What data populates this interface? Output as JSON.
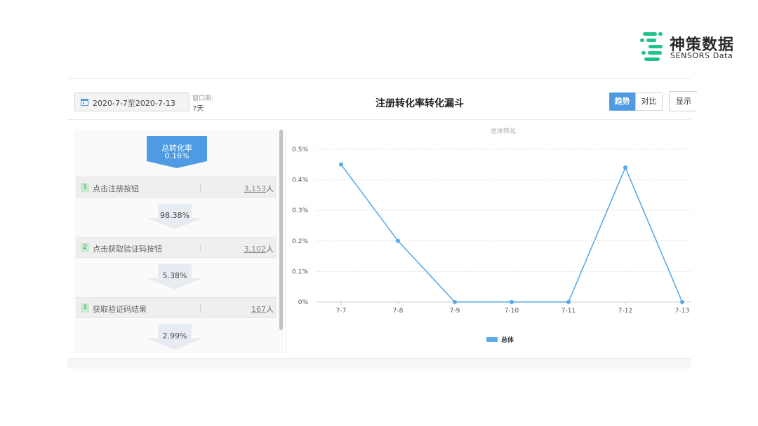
{
  "logo": {
    "name_cn": "神策数据",
    "name_en": "SENSORS Data"
  },
  "toolbar": {
    "date_range": "2020-7-7至2020-7-13",
    "window_label": "窗口期:",
    "window_value": "7天",
    "title": "注册转化率转化漏斗",
    "trend_label": "趋势",
    "compare_label": "对比",
    "display_label": "显示"
  },
  "funnel": {
    "total_label": "总转化率",
    "total_value": "0.16%",
    "steps": [
      {
        "index": "1",
        "name": "点击注册按钮",
        "count": "3,153",
        "unit": "人"
      },
      {
        "index": "2",
        "name": "点击获取验证码按钮",
        "count": "3,102",
        "unit": "人"
      },
      {
        "index": "3",
        "name": "获取验证码结果",
        "count": "167",
        "unit": "人"
      }
    ],
    "rates": [
      "98.38%",
      "5.38%",
      "2.99%"
    ]
  },
  "colors": {
    "accent": "#4e9be3",
    "line": "#5aaae8",
    "badge_green": "#c9ead1"
  },
  "chart_data": {
    "type": "line",
    "title": "总体转化",
    "categories": [
      "7-7",
      "7-8",
      "7-9",
      "7-10",
      "7-11",
      "7-12",
      "7-13"
    ],
    "series": [
      {
        "name": "总体",
        "values": [
          0.45,
          0.2,
          0,
          0,
          0,
          0.44,
          0
        ]
      }
    ],
    "y_ticks": [
      "0%",
      "0.1%",
      "0.2%",
      "0.3%",
      "0.4%",
      "0.5%"
    ],
    "ylim": [
      0,
      0.5
    ],
    "y_unit": "%",
    "grid": true,
    "legend": "bottom-center"
  }
}
